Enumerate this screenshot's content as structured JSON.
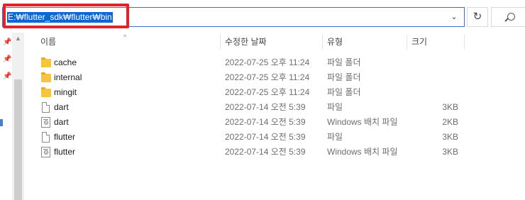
{
  "address_bar": {
    "path": "E:₩flutter_sdk₩flutter₩bin",
    "dropdown_icon": "chevron-down-icon"
  },
  "toolbar": {
    "refresh_icon": "↻",
    "search_icon": "search-icon"
  },
  "highlight_color": "#e3222c",
  "nav": {
    "pin_icon": "pin-icon"
  },
  "columns": {
    "name": "이름",
    "modified": "수정한 날짜",
    "type": "유형",
    "size": "크기"
  },
  "files": [
    {
      "name": "cache",
      "modified": "2022-07-25 오후 11:24",
      "type": "파일 폴더",
      "size": "",
      "icon": "folder-icon"
    },
    {
      "name": "internal",
      "modified": "2022-07-25 오후 11:24",
      "type": "파일 폴더",
      "size": "",
      "icon": "folder-icon"
    },
    {
      "name": "mingit",
      "modified": "2022-07-25 오후 11:24",
      "type": "파일 폴더",
      "size": "",
      "icon": "folder-icon"
    },
    {
      "name": "dart",
      "modified": "2022-07-14 오전 5:39",
      "type": "파일",
      "size": "3KB",
      "icon": "file-icon"
    },
    {
      "name": "dart",
      "modified": "2022-07-14 오전 5:39",
      "type": "Windows 배치 파일",
      "size": "2KB",
      "icon": "batch-file-icon"
    },
    {
      "name": "flutter",
      "modified": "2022-07-14 오전 5:39",
      "type": "파일",
      "size": "3KB",
      "icon": "file-icon"
    },
    {
      "name": "flutter",
      "modified": "2022-07-14 오전 5:39",
      "type": "Windows 배치 파일",
      "size": "3KB",
      "icon": "batch-file-icon"
    }
  ]
}
